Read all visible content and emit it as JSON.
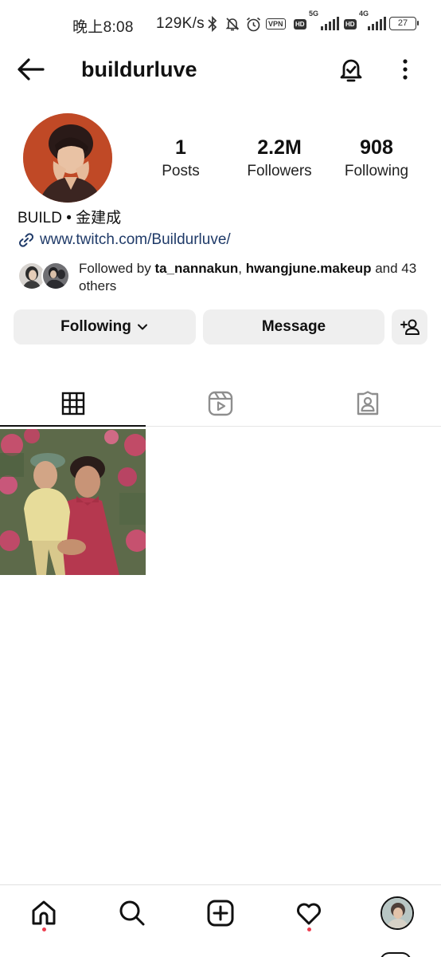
{
  "status_bar": {
    "time": "晚上8:08",
    "net_speed": "129K/s",
    "vpn": "VPN",
    "hd_1": "HD",
    "net_1": "5G",
    "hd_2": "HD",
    "net_2": "4G",
    "battery": "27"
  },
  "header": {
    "username": "buildurluve",
    "back_icon": "arrow-left-icon",
    "notification_icon": "bell-check-icon",
    "more_icon": "more-vertical-icon"
  },
  "profile": {
    "stats": [
      {
        "value": "1",
        "label": "Posts"
      },
      {
        "value": "2.2M",
        "label": "Followers"
      },
      {
        "value": "908",
        "label": "Following"
      }
    ],
    "display_name": "BUILD • 金建成",
    "link": "www.twitch.com/Buildurluve/",
    "followed_by": {
      "prefix": "Followed by ",
      "user1": "ta_nannakun",
      "sep": ", ",
      "user2": "hwangjune.makeup",
      "suffix": " and 43 others"
    }
  },
  "actions": {
    "following": "Following",
    "message": "Message",
    "add_user_icon": "add-person-icon"
  },
  "tabs": [
    {
      "name": "grid",
      "icon": "grid-icon",
      "active": true
    },
    {
      "name": "reels",
      "icon": "reels-icon",
      "active": false
    },
    {
      "name": "tagged",
      "icon": "tagged-icon",
      "active": false
    }
  ],
  "posts_count_shown": 1,
  "bottom_nav": [
    {
      "name": "home",
      "icon": "home-icon",
      "notification_dot": true
    },
    {
      "name": "search",
      "icon": "search-icon",
      "notification_dot": false
    },
    {
      "name": "create",
      "icon": "plus-square-icon",
      "notification_dot": false
    },
    {
      "name": "activity",
      "icon": "heart-icon",
      "notification_dot": true
    },
    {
      "name": "profile",
      "icon": "profile-avatar",
      "notification_dot": false
    }
  ],
  "colors": {
    "accent_link": "#1f3a68",
    "button_bg": "#efefef",
    "notification_dot": "#ed3e4f"
  }
}
